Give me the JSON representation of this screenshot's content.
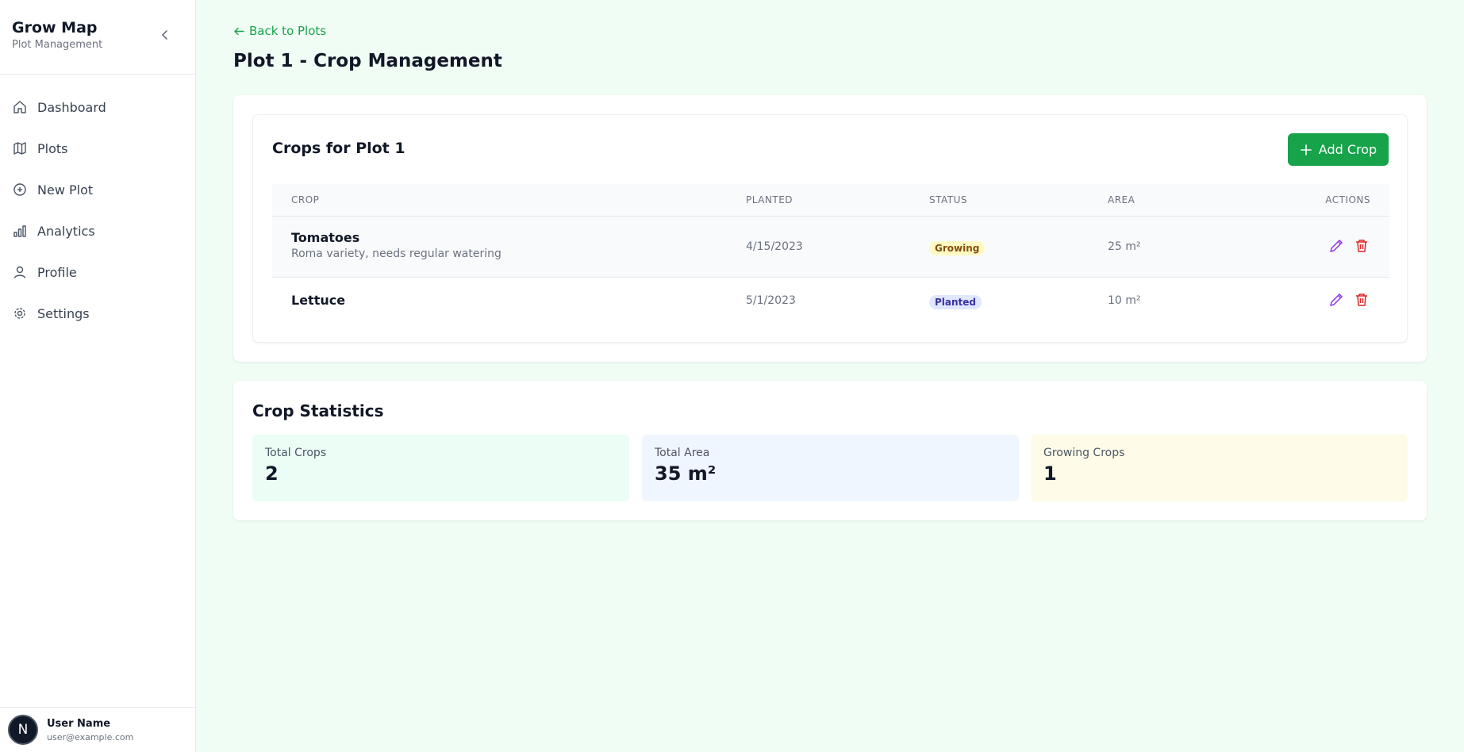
{
  "brand": {
    "title": "Grow Map",
    "subtitle": "Plot Management"
  },
  "nav": [
    {
      "label": "Dashboard",
      "icon": "home-icon"
    },
    {
      "label": "Plots",
      "icon": "map-icon"
    },
    {
      "label": "New Plot",
      "icon": "plus-circle-icon"
    },
    {
      "label": "Analytics",
      "icon": "bar-chart-icon"
    },
    {
      "label": "Profile",
      "icon": "user-icon"
    },
    {
      "label": "Settings",
      "icon": "gear-icon"
    }
  ],
  "user": {
    "initial": "N",
    "name": "User Name",
    "email": "user@example.com"
  },
  "back_link": "Back to Plots",
  "page_title": "Plot 1 - Crop Management",
  "crops_card": {
    "title": "Crops for Plot 1",
    "add_button": "Add Crop",
    "columns": [
      "CROP",
      "PLANTED",
      "STATUS",
      "AREA",
      "ACTIONS"
    ],
    "rows": [
      {
        "name": "Tomatoes",
        "note": "Roma variety, needs regular watering",
        "planted": "4/15/2023",
        "status": "Growing",
        "area": "25 m²"
      },
      {
        "name": "Lettuce",
        "note": "",
        "planted": "5/1/2023",
        "status": "Planted",
        "area": "10 m²"
      }
    ]
  },
  "stats": {
    "title": "Crop Statistics",
    "items": [
      {
        "label": "Total Crops",
        "value": "2",
        "color": "#ecfdf5"
      },
      {
        "label": "Total Area",
        "value": "35 m²",
        "color": "#eff6ff"
      },
      {
        "label": "Growing Crops",
        "value": "1",
        "color": "#fefce8"
      }
    ]
  },
  "colors": {
    "accent": "#16a34a",
    "edit": "#9333ea",
    "delete": "#dc2626",
    "background": "#f0fdf4"
  }
}
